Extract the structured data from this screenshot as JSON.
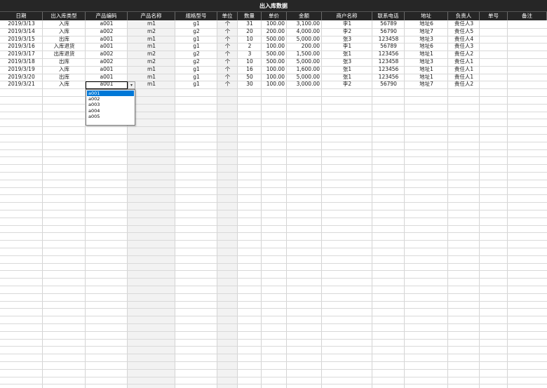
{
  "sheet": {
    "title": "出入库数据",
    "headers": [
      "日期",
      "出入库类型",
      "产品编码",
      "产品名称",
      "规格型号",
      "单位",
      "数量",
      "单价",
      "金额",
      "商户名称",
      "联系电话",
      "地址",
      "负责人",
      "单号",
      "备注"
    ],
    "rows": [
      [
        "2019/3/13",
        "入库",
        "a001",
        "m1",
        "g1",
        "个",
        "31",
        "100.00",
        "3,100.00",
        "李1",
        "56789",
        "地址6",
        "责任人3",
        "",
        ""
      ],
      [
        "2019/3/14",
        "入库",
        "a002",
        "m2",
        "g2",
        "个",
        "20",
        "200.00",
        "4,000.00",
        "李2",
        "56790",
        "地址7",
        "责任人5",
        "",
        ""
      ],
      [
        "2019/3/15",
        "出库",
        "a001",
        "m1",
        "g1",
        "个",
        "10",
        "500.00",
        "5,000.00",
        "张3",
        "123458",
        "地址3",
        "责任人4",
        "",
        ""
      ],
      [
        "2019/3/16",
        "入库退货",
        "a001",
        "m1",
        "g1",
        "个",
        "2",
        "100.00",
        "200.00",
        "李1",
        "56789",
        "地址6",
        "责任人3",
        "",
        ""
      ],
      [
        "2019/3/17",
        "出库退货",
        "a002",
        "m2",
        "g2",
        "个",
        "3",
        "500.00",
        "1,500.00",
        "张1",
        "123456",
        "地址1",
        "责任人2",
        "",
        ""
      ],
      [
        "2019/3/18",
        "出库",
        "a002",
        "m2",
        "g2",
        "个",
        "10",
        "500.00",
        "5,000.00",
        "张3",
        "123458",
        "地址3",
        "责任人1",
        "",
        ""
      ],
      [
        "2019/3/19",
        "入库",
        "a001",
        "m1",
        "g1",
        "个",
        "16",
        "100.00",
        "1,600.00",
        "张1",
        "123456",
        "地址1",
        "责任人1",
        "",
        ""
      ],
      [
        "2019/3/20",
        "出库",
        "a001",
        "m1",
        "g1",
        "个",
        "50",
        "100.00",
        "5,000.00",
        "张1",
        "123456",
        "地址1",
        "责任人1",
        "",
        ""
      ],
      [
        "2019/3/21",
        "入库",
        "a001",
        "m1",
        "g1",
        "个",
        "30",
        "100.00",
        "3,000.00",
        "李2",
        "56790",
        "地址7",
        "责任人2",
        "",
        ""
      ]
    ]
  },
  "dropdown": {
    "options": [
      "a001",
      "a002",
      "a003",
      "a004",
      "a005"
    ],
    "selected": "a001",
    "arrow_icon": "chevron-down-icon"
  },
  "colors": {
    "header_bg": "#262626",
    "header_text": "#ffffff",
    "shaded_column": "#f2f2f2",
    "selection": "#0078d7"
  }
}
